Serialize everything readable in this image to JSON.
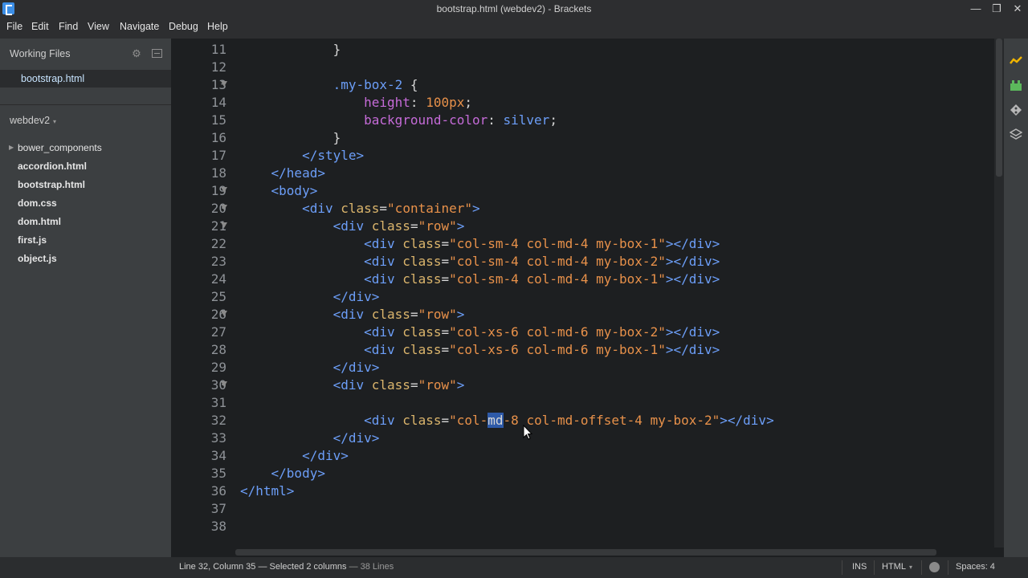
{
  "window": {
    "title": "bootstrap.html (webdev2) - Brackets",
    "minimize": "—",
    "restore": "❐",
    "close": "✕"
  },
  "menu": [
    "File",
    "Edit",
    "Find",
    "View",
    "Navigate",
    "Debug",
    "Help"
  ],
  "sidebar": {
    "working_files_label": "Working Files",
    "working_files": [
      "bootstrap.html"
    ],
    "project_name": "webdev2",
    "project_caret": "▾",
    "folder_arrow": "▶",
    "tree": [
      "bower_components",
      "accordion.html",
      "bootstrap.html",
      "dom.css",
      "dom.html",
      "first.js",
      "object.js"
    ]
  },
  "editor": {
    "lines": [
      {
        "n": "11",
        "fold": false,
        "tokens": [
          [
            "punc",
            "            }"
          ]
        ]
      },
      {
        "n": "12",
        "fold": false,
        "tokens": []
      },
      {
        "n": "13",
        "fold": true,
        "tokens": [
          [
            "punc",
            "            "
          ],
          [
            "sel",
            ".my-box-2"
          ],
          [
            "punc",
            " {"
          ]
        ]
      },
      {
        "n": "14",
        "fold": false,
        "tokens": [
          [
            "punc",
            "                "
          ],
          [
            "prop",
            "height"
          ],
          [
            "punc",
            ": "
          ],
          [
            "num",
            "100px"
          ],
          [
            "punc",
            ";"
          ]
        ]
      },
      {
        "n": "15",
        "fold": false,
        "tokens": [
          [
            "punc",
            "                "
          ],
          [
            "prop",
            "background-color"
          ],
          [
            "punc",
            ": "
          ],
          [
            "val",
            "silver"
          ],
          [
            "punc",
            ";"
          ]
        ]
      },
      {
        "n": "16",
        "fold": false,
        "tokens": [
          [
            "punc",
            "            }"
          ]
        ]
      },
      {
        "n": "17",
        "fold": false,
        "tokens": [
          [
            "punc",
            "        "
          ],
          [
            "tag",
            "</style>"
          ]
        ]
      },
      {
        "n": "18",
        "fold": false,
        "tokens": [
          [
            "punc",
            "    "
          ],
          [
            "tag",
            "</head>"
          ]
        ]
      },
      {
        "n": "19",
        "fold": true,
        "tokens": [
          [
            "punc",
            "    "
          ],
          [
            "tag",
            "<body>"
          ]
        ]
      },
      {
        "n": "20",
        "fold": true,
        "tokens": [
          [
            "punc",
            "        "
          ],
          [
            "tag",
            "<div "
          ],
          [
            "attr",
            "class"
          ],
          [
            "punc",
            "="
          ],
          [
            "str",
            "\"container\""
          ],
          [
            "tag",
            ">"
          ]
        ]
      },
      {
        "n": "21",
        "fold": true,
        "tokens": [
          [
            "punc",
            "            "
          ],
          [
            "tag",
            "<div "
          ],
          [
            "attr",
            "class"
          ],
          [
            "punc",
            "="
          ],
          [
            "str",
            "\"row\""
          ],
          [
            "tag",
            ">"
          ]
        ]
      },
      {
        "n": "22",
        "fold": false,
        "tokens": [
          [
            "punc",
            "                "
          ],
          [
            "tag",
            "<div "
          ],
          [
            "attr",
            "class"
          ],
          [
            "punc",
            "="
          ],
          [
            "str",
            "\"col-sm-4 col-md-4 my-box-1\""
          ],
          [
            "tag",
            "></div>"
          ]
        ]
      },
      {
        "n": "23",
        "fold": false,
        "tokens": [
          [
            "punc",
            "                "
          ],
          [
            "tag",
            "<div "
          ],
          [
            "attr",
            "class"
          ],
          [
            "punc",
            "="
          ],
          [
            "str",
            "\"col-sm-4 col-md-4 my-box-2\""
          ],
          [
            "tag",
            "></div>"
          ]
        ]
      },
      {
        "n": "24",
        "fold": false,
        "tokens": [
          [
            "punc",
            "                "
          ],
          [
            "tag",
            "<div "
          ],
          [
            "attr",
            "class"
          ],
          [
            "punc",
            "="
          ],
          [
            "str",
            "\"col-sm-4 col-md-4 my-box-1\""
          ],
          [
            "tag",
            "></div>"
          ]
        ]
      },
      {
        "n": "25",
        "fold": false,
        "tokens": [
          [
            "punc",
            "            "
          ],
          [
            "tag",
            "</div>"
          ]
        ]
      },
      {
        "n": "26",
        "fold": true,
        "tokens": [
          [
            "punc",
            "            "
          ],
          [
            "tag",
            "<div "
          ],
          [
            "attr",
            "class"
          ],
          [
            "punc",
            "="
          ],
          [
            "str",
            "\"row\""
          ],
          [
            "tag",
            ">"
          ]
        ]
      },
      {
        "n": "27",
        "fold": false,
        "tokens": [
          [
            "punc",
            "                "
          ],
          [
            "tag",
            "<div "
          ],
          [
            "attr",
            "class"
          ],
          [
            "punc",
            "="
          ],
          [
            "str",
            "\"col-xs-6 col-md-6 my-box-2\""
          ],
          [
            "tag",
            "></div>"
          ]
        ]
      },
      {
        "n": "28",
        "fold": false,
        "tokens": [
          [
            "punc",
            "                "
          ],
          [
            "tag",
            "<div "
          ],
          [
            "attr",
            "class"
          ],
          [
            "punc",
            "="
          ],
          [
            "str",
            "\"col-xs-6 col-md-6 my-box-1\""
          ],
          [
            "tag",
            "></div>"
          ]
        ]
      },
      {
        "n": "29",
        "fold": false,
        "tokens": [
          [
            "punc",
            "            "
          ],
          [
            "tag",
            "</div>"
          ]
        ]
      },
      {
        "n": "30",
        "fold": true,
        "tokens": [
          [
            "punc",
            "            "
          ],
          [
            "tag",
            "<div "
          ],
          [
            "attr",
            "class"
          ],
          [
            "punc",
            "="
          ],
          [
            "str",
            "\"row\""
          ],
          [
            "tag",
            ">"
          ]
        ]
      },
      {
        "n": "31",
        "fold": false,
        "tokens": []
      },
      {
        "n": "32",
        "fold": false,
        "tokens": [
          [
            "punc",
            "                "
          ],
          [
            "tag",
            "<div "
          ],
          [
            "attr",
            "class"
          ],
          [
            "punc",
            "="
          ],
          [
            "str",
            "\"col-"
          ],
          [
            "selection",
            "md"
          ],
          [
            "str",
            "-8 col-md-offset-4 my-box-2\""
          ],
          [
            "tag",
            "></div>"
          ]
        ]
      },
      {
        "n": "33",
        "fold": false,
        "tokens": [
          [
            "punc",
            "            "
          ],
          [
            "tag",
            "</div>"
          ]
        ]
      },
      {
        "n": "34",
        "fold": false,
        "tokens": [
          [
            "punc",
            "        "
          ],
          [
            "tag",
            "</div>"
          ]
        ]
      },
      {
        "n": "35",
        "fold": false,
        "tokens": [
          [
            "punc",
            "    "
          ],
          [
            "tag",
            "</body>"
          ]
        ]
      },
      {
        "n": "36",
        "fold": false,
        "tokens": [
          [
            "tag",
            "</html>"
          ]
        ]
      },
      {
        "n": "37",
        "fold": false,
        "tokens": []
      },
      {
        "n": "38",
        "fold": false,
        "tokens": []
      }
    ]
  },
  "status": {
    "position": "Line 32, Column 35 — Selected 2 columns",
    "lines": " — 38 Lines",
    "mode": "INS",
    "language": "HTML",
    "language_caret": "▾",
    "spaces": "Spaces: 4"
  },
  "icons": [
    "live-preview-icon",
    "extension-manager-icon",
    "git-icon",
    "layers-icon",
    "gear-icon",
    "split-view-icon",
    "mouse-cursor-icon"
  ],
  "colors": {
    "editor_bg": "#1d1f21",
    "sidebar_bg": "#3c3f41",
    "tag": "#6c9ef8",
    "attr": "#dbb56c",
    "string": "#e8914a",
    "property": "#c56bd8",
    "selection": "#2e5aa8"
  }
}
